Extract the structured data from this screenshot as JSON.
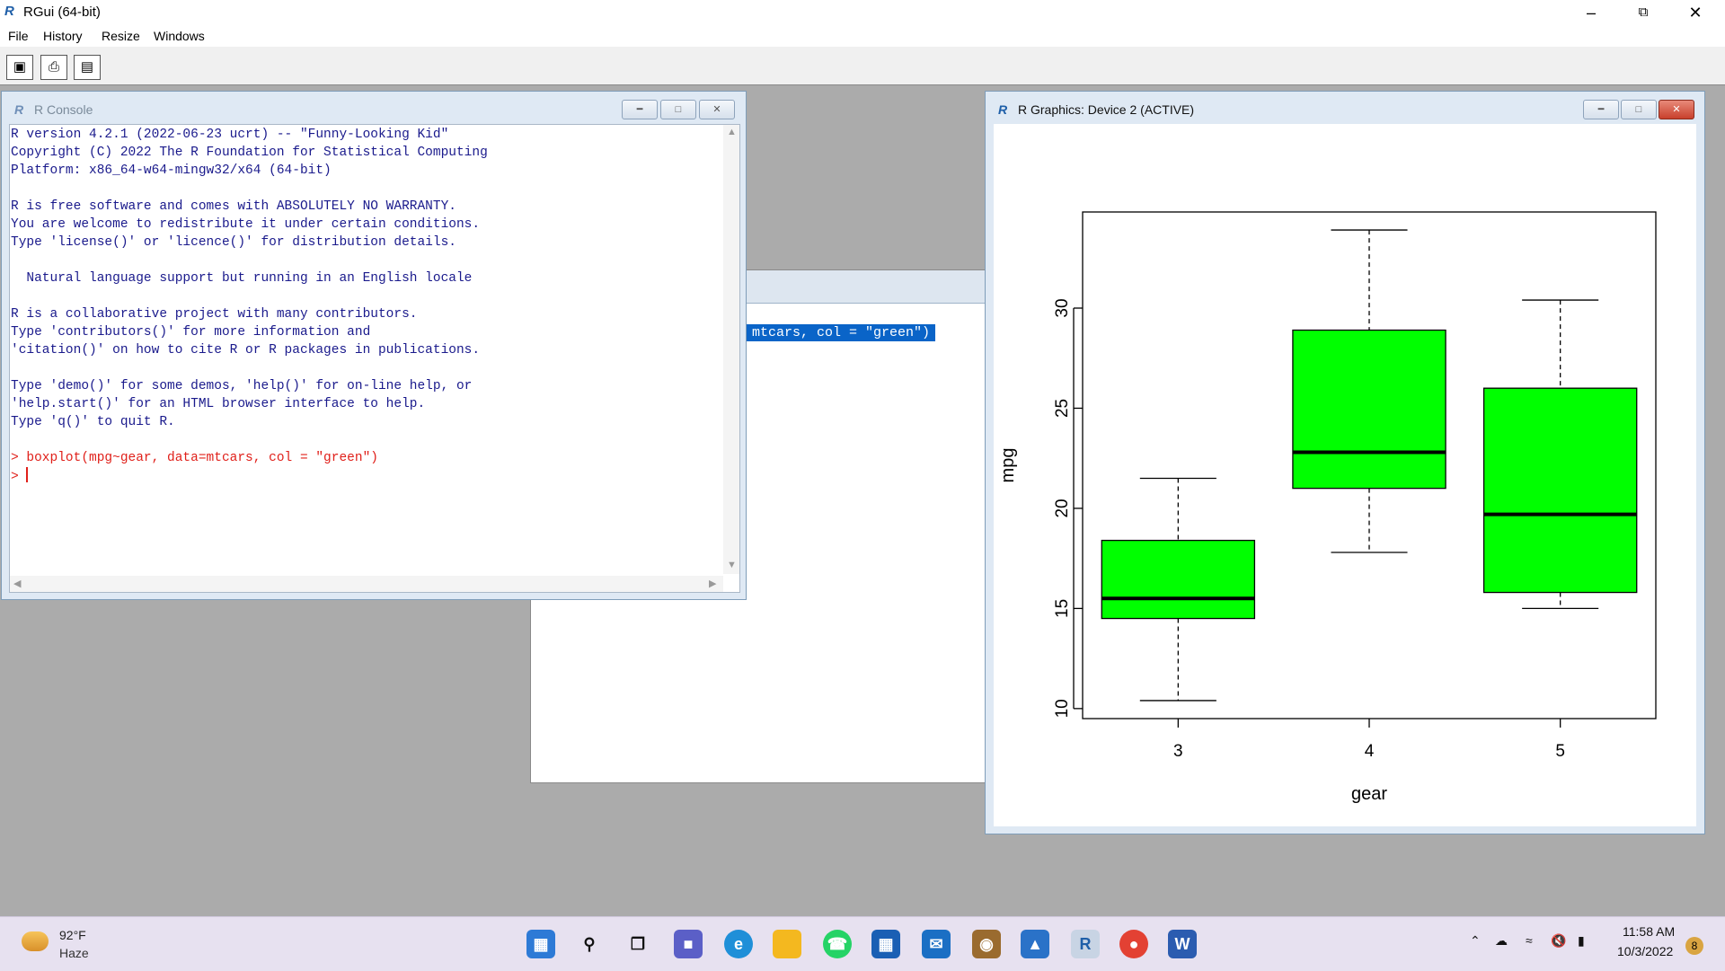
{
  "app": {
    "title": "RGui (64-bit)"
  },
  "menu": [
    "File",
    "History",
    "Resize",
    "Windows"
  ],
  "toolbar": {
    "icons": [
      "open-script-icon",
      "print-icon",
      "window-icon"
    ]
  },
  "background_window": {
    "selected_text": "mtcars, col = \"green\")"
  },
  "console": {
    "title": "R Console",
    "lines": [
      "R version 4.2.1 (2022-06-23 ucrt) -- \"Funny-Looking Kid\"",
      "Copyright (C) 2022 The R Foundation for Statistical Computing",
      "Platform: x86_64-w64-mingw32/x64 (64-bit)",
      "",
      "R is free software and comes with ABSOLUTELY NO WARRANTY.",
      "You are welcome to redistribute it under certain conditions.",
      "Type 'license()' or 'licence()' for distribution details.",
      "",
      "  Natural language support but running in an English locale",
      "",
      "R is a collaborative project with many contributors.",
      "Type 'contributors()' for more information and",
      "'citation()' on how to cite R or R packages in publications.",
      "",
      "Type 'demo()' for some demos, 'help()' for on-line help, or",
      "'help.start()' for an HTML browser interface to help.",
      "Type 'q()' to quit R.",
      ""
    ],
    "command": "> boxplot(mpg~gear, data=mtcars, col = \"green\")",
    "prompt": "> "
  },
  "graphics": {
    "title": "R Graphics: Device 2 (ACTIVE)"
  },
  "chart_data": {
    "type": "boxplot",
    "categories": [
      "3",
      "4",
      "5"
    ],
    "boxes": [
      {
        "category": "3",
        "whisker_low": 10.4,
        "q1": 14.5,
        "median": 15.5,
        "q3": 18.4,
        "whisker_high": 21.5
      },
      {
        "category": "4",
        "whisker_low": 17.8,
        "q1": 21.0,
        "median": 22.8,
        "q3": 28.9,
        "whisker_high": 33.9
      },
      {
        "category": "5",
        "whisker_low": 15.0,
        "q1": 15.8,
        "median": 19.7,
        "q3": 26.0,
        "whisker_high": 30.4
      }
    ],
    "fill": "#00ff00",
    "xlabel": "gear",
    "ylabel": "mpg",
    "yticks": [
      10,
      15,
      20,
      25,
      30
    ],
    "ylim": [
      9.5,
      34.8
    ]
  },
  "taskbar": {
    "weather_temp": "92°F",
    "weather_desc": "Haze",
    "time": "11:58 AM",
    "date": "10/3/2022",
    "notifications": "8",
    "apps": [
      "windows-start-icon",
      "search-icon",
      "task-view-icon",
      "teams-chat-icon",
      "edge-icon",
      "file-explorer-icon",
      "whatsapp-icon",
      "store-icon",
      "mail-icon",
      "app-icon",
      "photos-icon",
      "r-gui-icon",
      "chrome-icon",
      "word-icon"
    ]
  }
}
